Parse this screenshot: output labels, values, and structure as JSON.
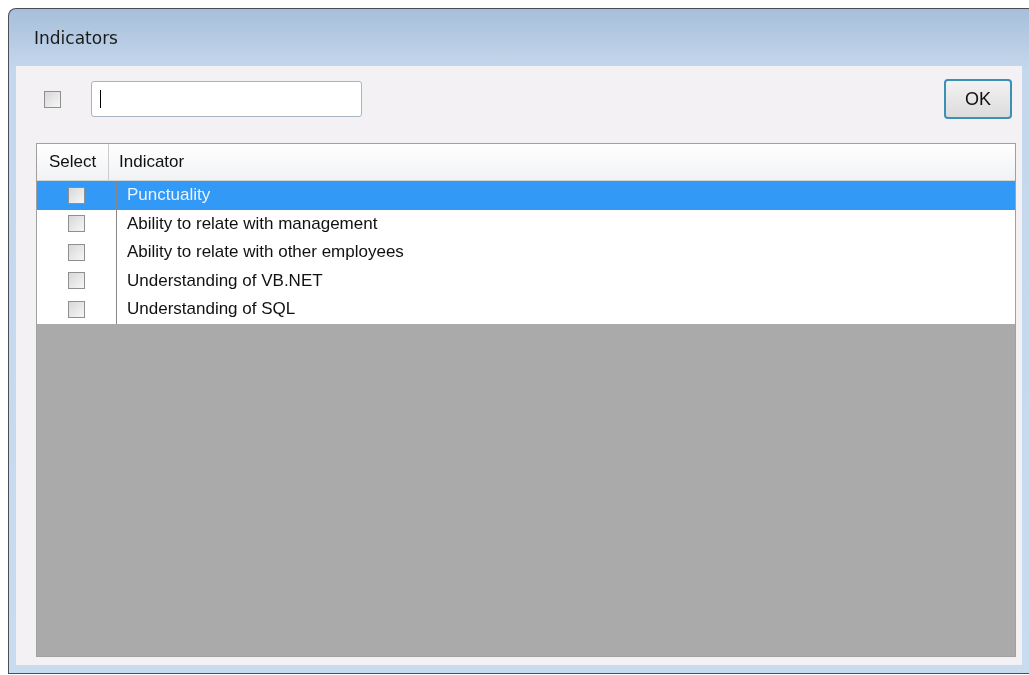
{
  "window": {
    "title": "Indicators"
  },
  "toolbar": {
    "select_all": {
      "checked": false
    },
    "ok_button": "OK"
  },
  "table": {
    "columns": [
      "Select",
      "Indicator"
    ],
    "rows": [
      {
        "indicator": "Punctuality",
        "checked": false,
        "selected": true
      },
      {
        "indicator": "Ability to relate with management",
        "checked": false,
        "selected": false
      },
      {
        "indicator": "Ability to relate with other employees",
        "checked": false,
        "selected": false
      },
      {
        "indicator": "Understanding of VB.NET",
        "checked": false,
        "selected": false
      },
      {
        "indicator": "Understanding of SQL",
        "checked": false,
        "selected": false
      }
    ]
  }
}
